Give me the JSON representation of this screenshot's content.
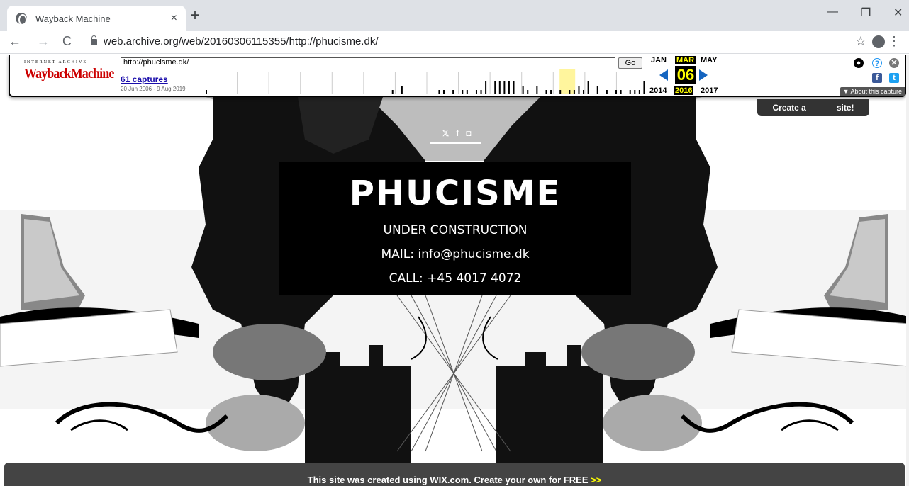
{
  "browser": {
    "tab_title": "Wayback Machine",
    "tab_close": "×",
    "new_tab": "+",
    "url": "web.archive.org/web/20160306115355/http://phucisme.dk/",
    "window_controls": [
      "—",
      "❐",
      "✕"
    ],
    "nav": {
      "back": "←",
      "forward": "→",
      "reload": "C"
    },
    "star": "☆",
    "menu": "⋮"
  },
  "wayback": {
    "logo_top": "INTERNET ARCHIVE",
    "logo": "WaybackMachine",
    "input_value": "http://phucisme.dk/",
    "go_label": "Go",
    "captures": "61 captures",
    "range": "20 Jun 2006 - 9 Aug 2019",
    "months": {
      "prev": "JAN",
      "cur": "MAR",
      "next": "MAY"
    },
    "day": "06",
    "years": {
      "prev": "2014",
      "cur": "2016",
      "next": "2017"
    },
    "about": "▼ About this capture",
    "help_icon": "?",
    "close_icon": "✕",
    "fb_icon": "f",
    "tw_icon": "t",
    "user_icon": "●",
    "spark_values": [
      1,
      0,
      0,
      0,
      0,
      0,
      0,
      0,
      0,
      0,
      0,
      0,
      0,
      0,
      0,
      0,
      0,
      0,
      0,
      0,
      0,
      0,
      0,
      0,
      0,
      0,
      0,
      0,
      0,
      0,
      0,
      0,
      0,
      0,
      0,
      0,
      0,
      0,
      0,
      0,
      1,
      0,
      2,
      0,
      0,
      0,
      0,
      0,
      0,
      0,
      1,
      1,
      0,
      1,
      0,
      1,
      1,
      0,
      1,
      1,
      3,
      0,
      3,
      3,
      3,
      3,
      3,
      0,
      2,
      1,
      0,
      2,
      0,
      1,
      1,
      0,
      1,
      0,
      1,
      1,
      2,
      1,
      3,
      0,
      2,
      0,
      1,
      0,
      1,
      1,
      0,
      1,
      1,
      1,
      3
    ]
  },
  "create_badge": {
    "left": "Create a",
    "right": "site!"
  },
  "social": [
    "𝕏",
    "f",
    "◘"
  ],
  "content": {
    "brand": "PHUCISME",
    "line1": "UNDER CONSTRUCTION",
    "line2": "MAIL: info@phucisme.dk",
    "line3": "CALL: +45 4017 4072"
  },
  "footer": {
    "text": "This site was created using WIX.com. Create your own for FREE",
    "arrows": ">>"
  },
  "colors": {
    "accent_yellow": "#ffff00",
    "wayback_blue": "#1565c0",
    "wayback_red": "#cc0000"
  }
}
